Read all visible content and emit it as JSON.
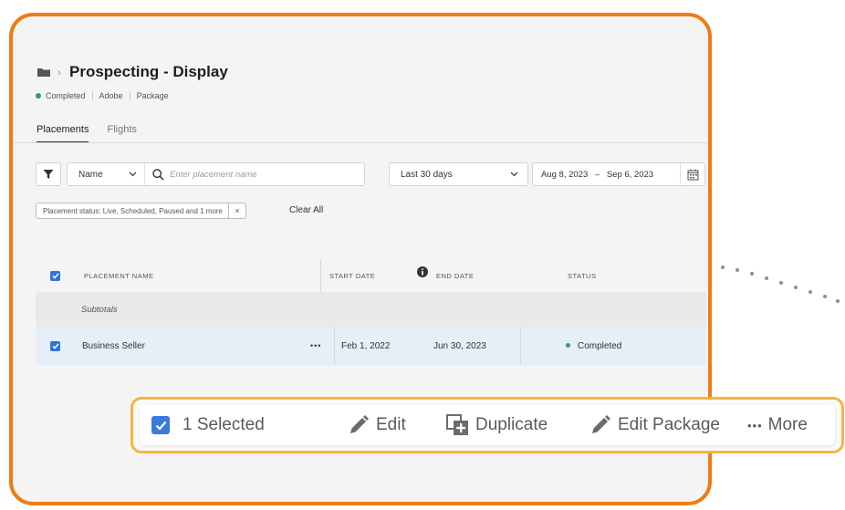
{
  "header": {
    "title": "Prospecting - Display",
    "status": "Completed",
    "advertiser": "Adobe",
    "type": "Package"
  },
  "tabs": [
    {
      "label": "Placements",
      "active": true
    },
    {
      "label": "Flights",
      "active": false
    }
  ],
  "toolbar": {
    "search_field_select": "Name",
    "search_placeholder": "Enter placement name",
    "date_preset": "Last 30 days",
    "date_start": "Aug 8, 2023",
    "date_separator": "–",
    "date_end": "Sep 6, 2023"
  },
  "filter_chip": {
    "label": "Placement status: Live, Scheduled, Paused and 1 more",
    "remove": "×"
  },
  "clear_all": "Clear All",
  "table": {
    "columns": [
      "PLACEMENT NAME",
      "START DATE",
      "END DATE",
      "STATUS"
    ],
    "subtotal_label": "Subtotals",
    "rows": [
      {
        "name": "Business Seller",
        "more": "•••",
        "start_date": "Feb 1, 2022",
        "end_date": "Jun 30, 2023",
        "status": "Completed",
        "checked": true
      }
    ]
  },
  "action_bar": {
    "selected": "1 Selected",
    "edit": "Edit",
    "duplicate": "Duplicate",
    "edit_package": "Edit Package",
    "more_dots": "•••",
    "more": "More"
  },
  "colors": {
    "frame": "#f07b14",
    "action_bar_border": "#f5b53f",
    "checkbox": "#2f74d8",
    "status_green": "#2d9d78",
    "selected_row": "#e6eef8"
  }
}
